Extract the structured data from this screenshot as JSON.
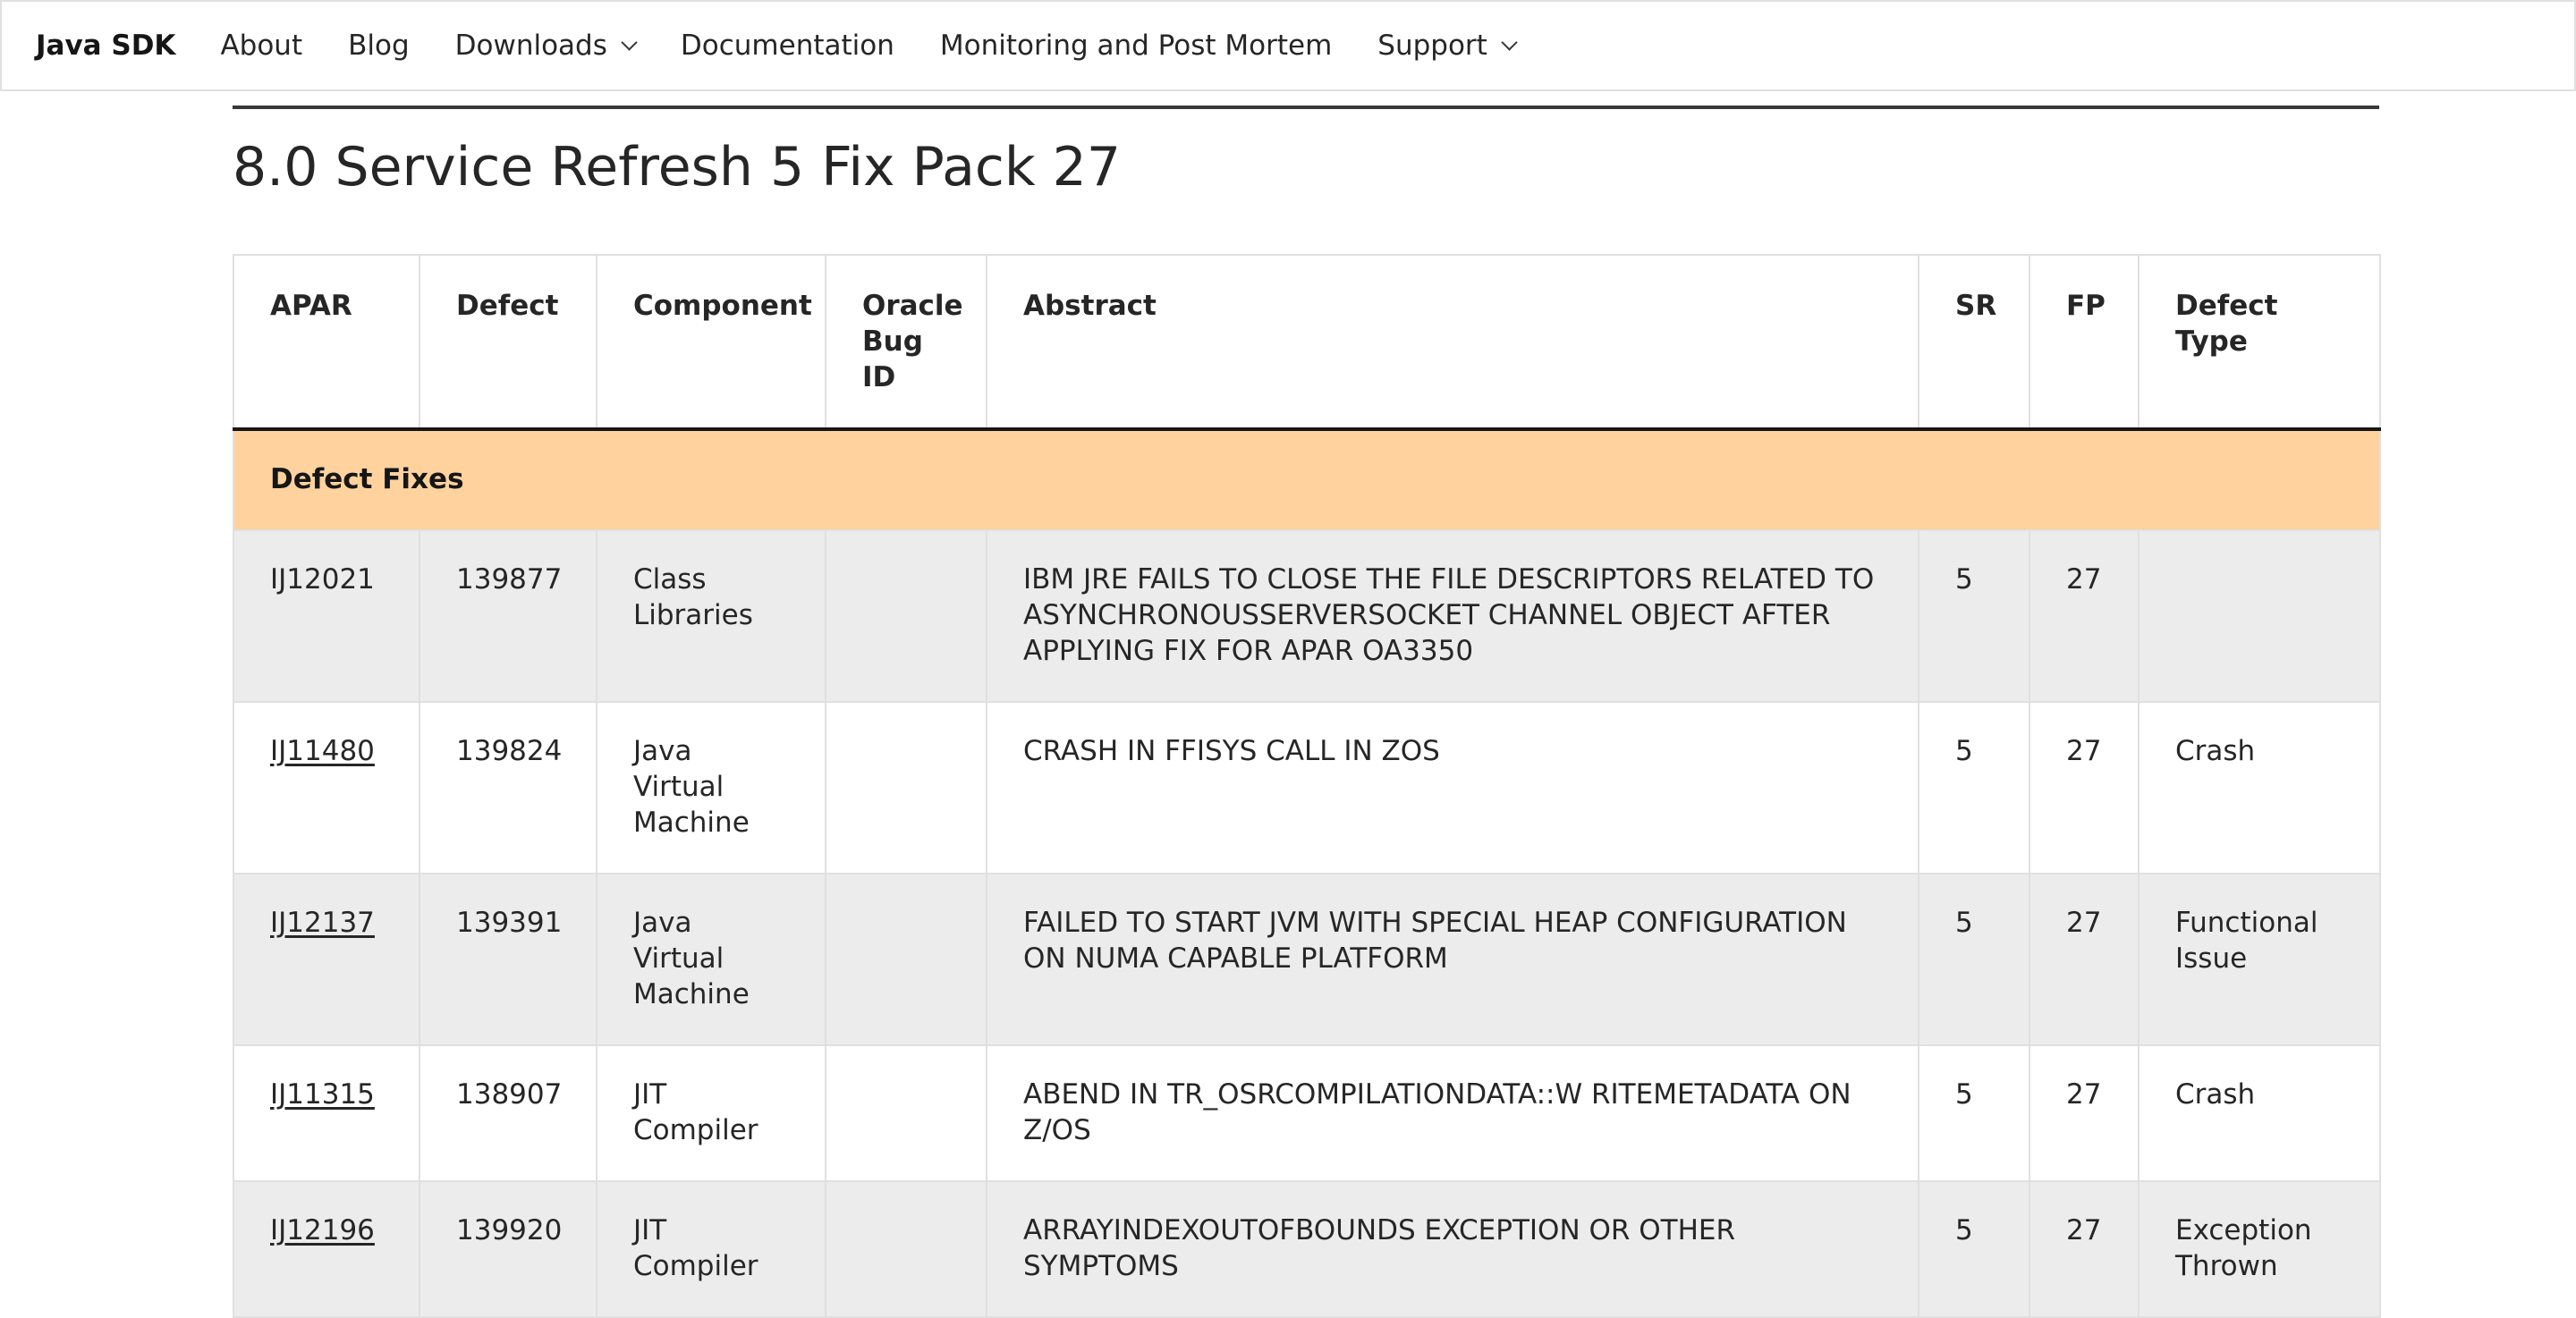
{
  "nav": {
    "brand": "Java SDK",
    "items": [
      {
        "label": "About"
      },
      {
        "label": "Blog"
      },
      {
        "label": "Downloads"
      },
      {
        "label": "Documentation"
      },
      {
        "label": "Monitoring and Post Mortem"
      },
      {
        "label": "Support"
      }
    ]
  },
  "page": {
    "title": "8.0 Service Refresh 5 Fix Pack 27"
  },
  "table": {
    "headers": {
      "apar": "APAR",
      "defect": "Defect",
      "component": "Component",
      "oracle": "Oracle Bug ID",
      "abstract": "Abstract",
      "sr": "SR",
      "fp": "FP",
      "type": "Defect Type"
    },
    "group_label": "Defect Fixes",
    "rows": [
      {
        "apar": "IJ12021",
        "defect": "139877",
        "component": "Class Libraries",
        "oracle": "",
        "abstract": "IBM JRE FAILS TO CLOSE THE FILE DESCRIPTORS RELATED TO ASYNCHRONOUSSERVERSOCKET CHANNEL OBJECT AFTER APPLYING FIX FOR APAR OA3350",
        "sr": "5",
        "fp": "27",
        "type": ""
      },
      {
        "apar": "IJ11480",
        "defect": "139824",
        "component": "Java Virtual Machine",
        "oracle": "",
        "abstract": "CRASH IN FFISYS CALL IN ZOS",
        "sr": "5",
        "fp": "27",
        "type": "Crash"
      },
      {
        "apar": "IJ12137",
        "defect": "139391",
        "component": "Java Virtual Machine",
        "oracle": "",
        "abstract": "FAILED TO START JVM WITH SPECIAL HEAP CONFIGURATION ON NUMA CAPABLE PLATFORM",
        "sr": "5",
        "fp": "27",
        "type": "Functional Issue"
      },
      {
        "apar": "IJ11315",
        "defect": "138907",
        "component": "JIT Compiler",
        "oracle": "",
        "abstract": "ABEND IN TR_OSRCOMPILATIONDATA::W RITEMETADATA ON Z/OS",
        "sr": "5",
        "fp": "27",
        "type": "Crash"
      },
      {
        "apar": "IJ12196",
        "defect": "139920",
        "component": "JIT Compiler",
        "oracle": "",
        "abstract": "ARRAYINDEXOUTOFBOUNDS EXCEPTION OR OTHER SYMPTOMS",
        "sr": "5",
        "fp": "27",
        "type": "Exception Thrown"
      }
    ]
  }
}
